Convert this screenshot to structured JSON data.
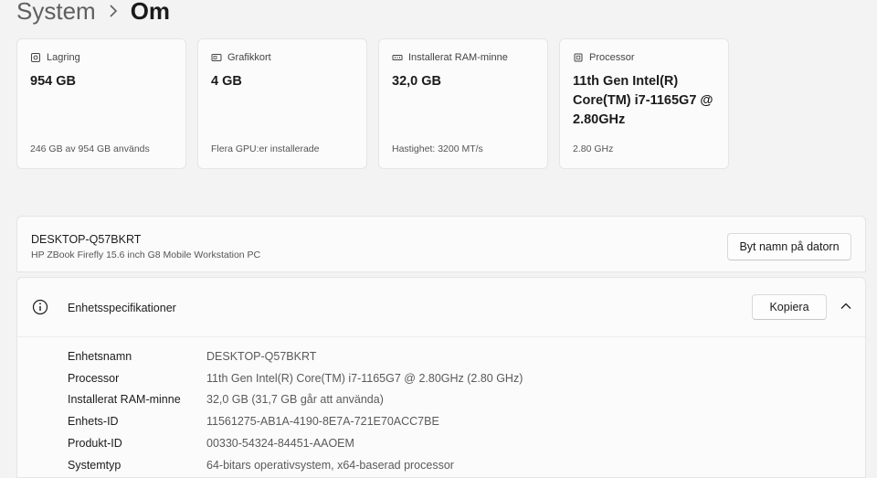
{
  "breadcrumb": {
    "parent": "System",
    "current": "Om"
  },
  "cards": [
    {
      "icon": "storage-icon",
      "label": "Lagring",
      "value": "954 GB",
      "sub": "246 GB av 954 GB används"
    },
    {
      "icon": "gpu-icon",
      "label": "Grafikkort",
      "value": "4 GB",
      "sub": "Flera GPU:er installerade"
    },
    {
      "icon": "ram-icon",
      "label": "Installerat RAM-minne",
      "value": "32,0 GB",
      "sub": "Hastighet: 3200 MT/s"
    },
    {
      "icon": "processor-icon",
      "label": "Processor",
      "value": "11th Gen Intel(R) Core(TM) i7-1165G7 @ 2.80GHz",
      "sub": "2.80 GHz"
    }
  ],
  "device": {
    "name": "DESKTOP-Q57BKRT",
    "model": "HP ZBook Firefly 15.6 inch G8 Mobile Workstation PC",
    "rename_label": "Byt namn på datorn"
  },
  "specs": {
    "title": "Enhetsspecifikationer",
    "copy_label": "Kopiera",
    "rows": [
      {
        "label": "Enhetsnamn",
        "value": "DESKTOP-Q57BKRT"
      },
      {
        "label": "Processor",
        "value": "11th Gen Intel(R) Core(TM) i7-1165G7 @ 2.80GHz (2.80 GHz)"
      },
      {
        "label": "Installerat RAM-minne",
        "value": "32,0 GB (31,7 GB går att använda)"
      },
      {
        "label": "Enhets-ID",
        "value": "11561275-AB1A-4190-8E7A-721E70ACC7BE"
      },
      {
        "label": "Produkt-ID",
        "value": "00330-54324-84451-AAOEM"
      },
      {
        "label": "Systemtyp",
        "value": "64-bitars operativsystem, x64-baserad processor"
      }
    ]
  }
}
